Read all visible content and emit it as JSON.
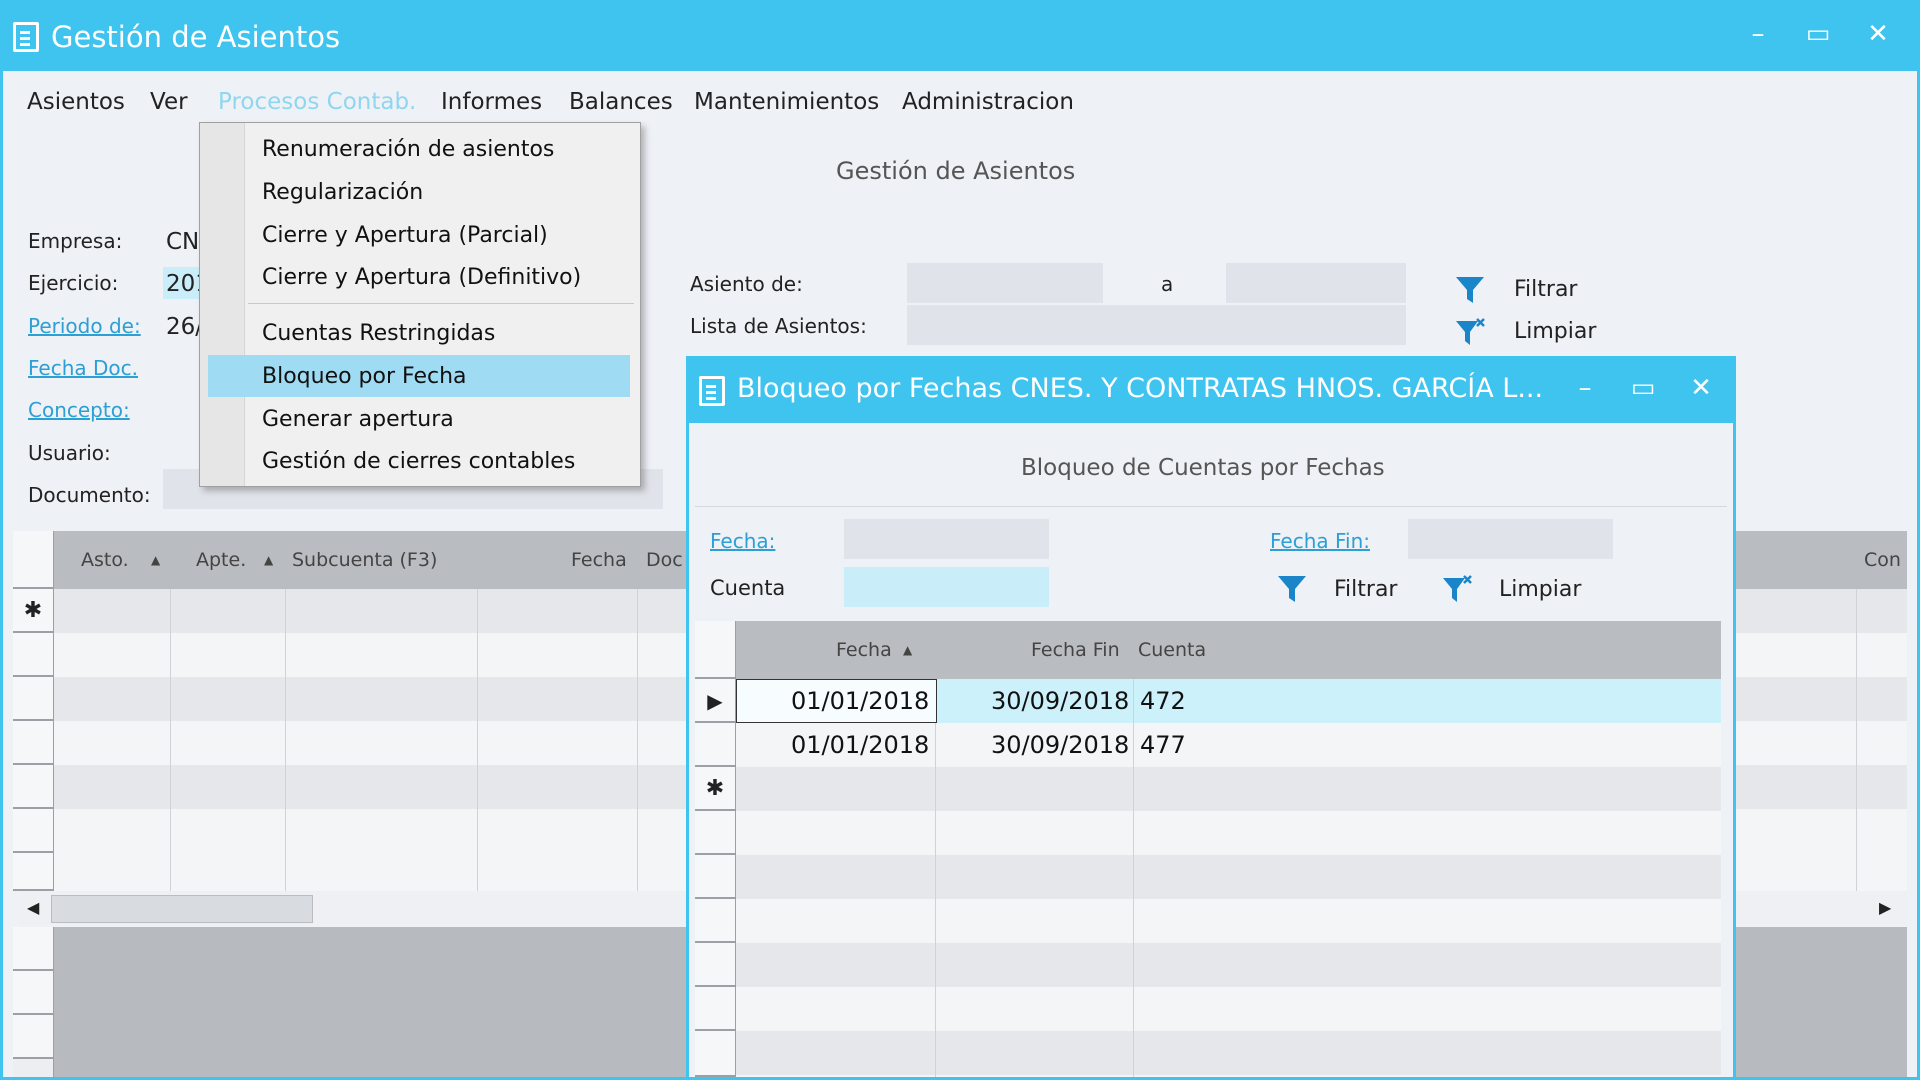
{
  "window": {
    "title": "Gestión de Asientos",
    "minimize": "–",
    "maximize": "▭",
    "close": "✕"
  },
  "menu": [
    "Asientos",
    "Ver",
    "Procesos Contab.",
    "Informes",
    "Balances",
    "Mantenimientos",
    "Administracion"
  ],
  "page_title": "Gestión de Asientos",
  "form": {
    "empresa_label": "Empresa:",
    "empresa_value": "CN",
    "ejercicio_label": "Ejercicio:",
    "ejercicio_value": "201",
    "periodo_label": "Periodo de:",
    "periodo_value": "26/",
    "fecha_doc_label": "Fecha Doc.",
    "concepto_label": "Concepto:",
    "usuario_label": "Usuario:",
    "documento_label": "Documento:",
    "asiento_de_label": "Asiento de:",
    "a_label": "a",
    "lista_label": "Lista de Asientos:",
    "filtrar": "Filtrar",
    "limpiar": "Limpiar"
  },
  "grid": {
    "columns": [
      "Asto.",
      "Apte.",
      "Subcuenta (F3)",
      "Fecha",
      "Doc",
      "Con"
    ],
    "new_row_marker": "✱"
  },
  "dropdown": [
    "Renumeración de asientos",
    "Regularización",
    "Cierre y Apertura (Parcial)",
    "Cierre y Apertura (Definitivo)",
    "Cuentas Restringidas",
    "Bloqueo por Fecha",
    "Generar apertura",
    "Gestión de cierres contables"
  ],
  "dialog": {
    "title": "Bloqueo por Fechas CNES. Y CONTRATAS HNOS. GARCÍA L...",
    "heading": "Bloqueo de Cuentas por Fechas",
    "fecha_label": "Fecha:",
    "fecha_fin_label": "Fecha Fin:",
    "cuenta_label": "Cuenta",
    "filtrar": "Filtrar",
    "limpiar": "Limpiar",
    "columns": [
      "Fecha",
      "Fecha Fin",
      "Cuenta"
    ],
    "rows": [
      {
        "fecha": "01/01/2018",
        "fecha_fin": "30/09/2018",
        "cuenta": "472"
      },
      {
        "fecha": "01/01/2018",
        "fecha_fin": "30/09/2018",
        "cuenta": "477"
      }
    ],
    "new_row_marker": "✱"
  },
  "colors": {
    "accent": "#3fc3ef",
    "highlight": "#9fdcf3",
    "link": "#2c9fd4"
  },
  "icons": [
    "document-icon",
    "filter-icon",
    "clear-filter-icon",
    "current-row-arrow-icon"
  ]
}
